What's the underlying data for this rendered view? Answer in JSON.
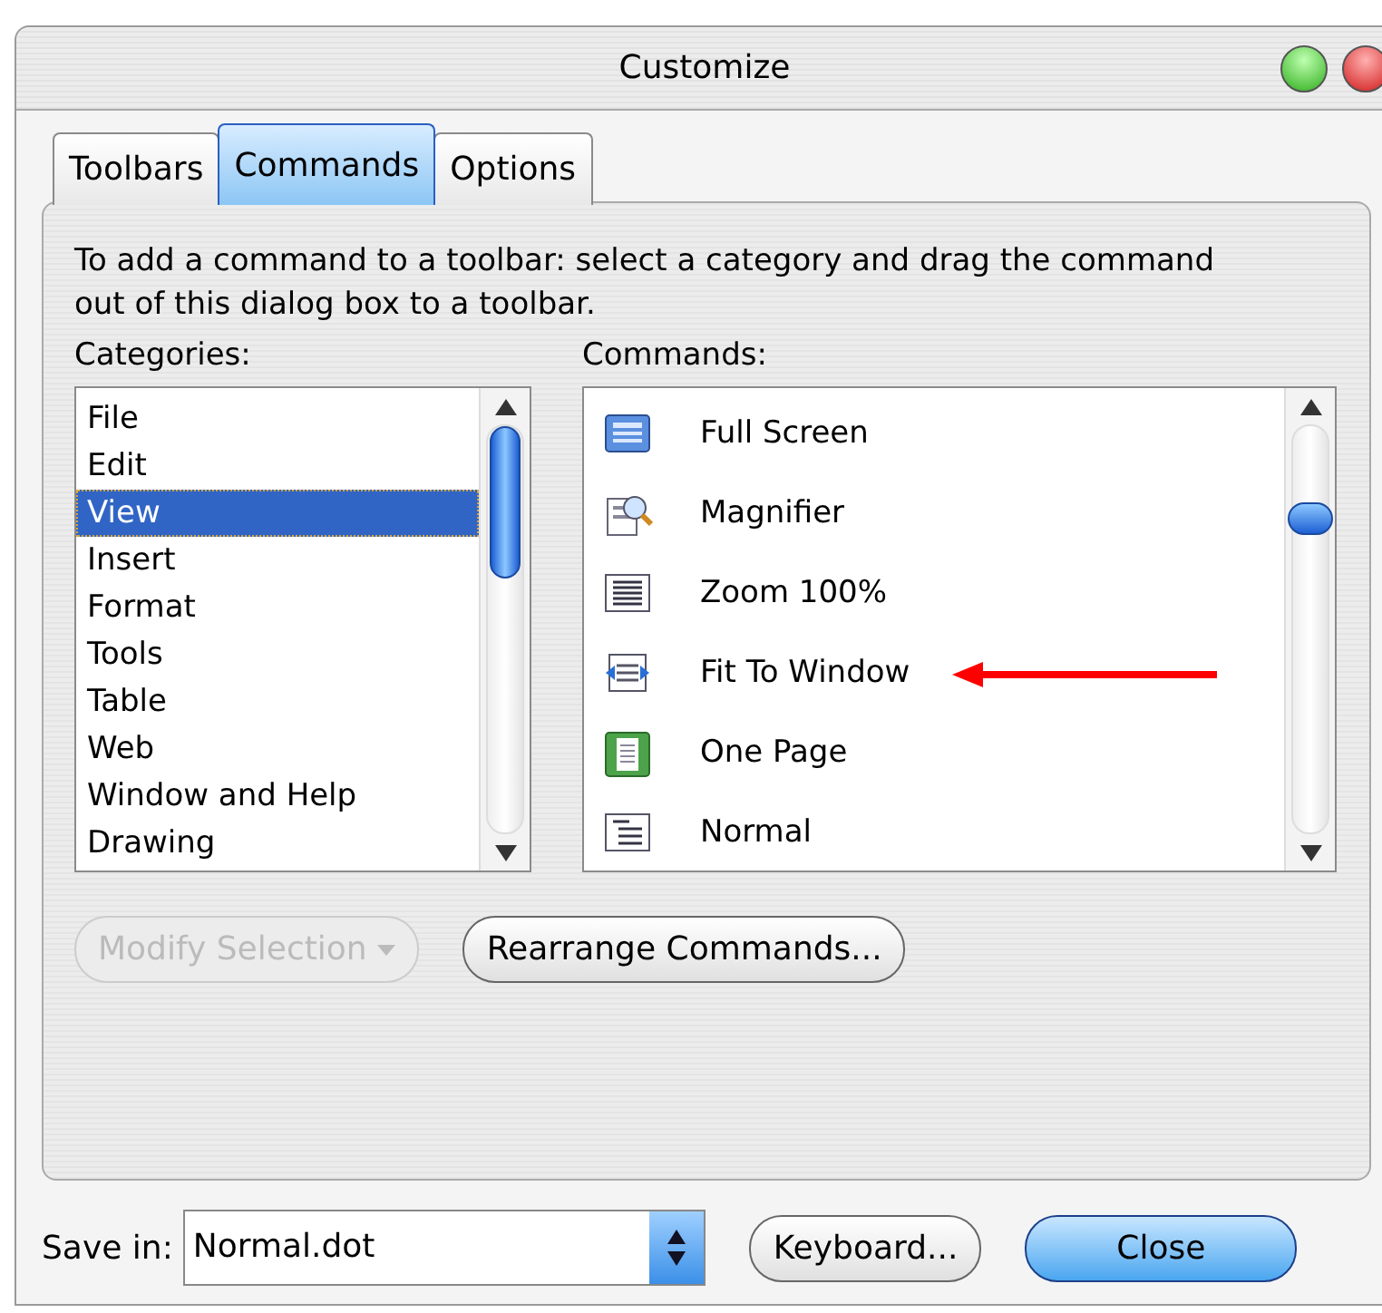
{
  "window": {
    "title": "Customize"
  },
  "tabs": [
    {
      "label": "Toolbars",
      "selected": false
    },
    {
      "label": "Commands",
      "selected": true
    },
    {
      "label": "Options",
      "selected": false
    }
  ],
  "instructions": "To add a command to a toolbar: select a category and drag the command out of this dialog box to a toolbar.",
  "categories": {
    "label": "Categories:",
    "items": [
      {
        "label": "File",
        "selected": false
      },
      {
        "label": "Edit",
        "selected": false
      },
      {
        "label": "View",
        "selected": true
      },
      {
        "label": "Insert",
        "selected": false
      },
      {
        "label": "Format",
        "selected": false
      },
      {
        "label": "Tools",
        "selected": false
      },
      {
        "label": "Table",
        "selected": false
      },
      {
        "label": "Web",
        "selected": false
      },
      {
        "label": "Window and Help",
        "selected": false
      },
      {
        "label": "Drawing",
        "selected": false
      }
    ]
  },
  "commands": {
    "label": "Commands:",
    "items": [
      {
        "label": "Full Screen",
        "kind": "screen",
        "annotated": false
      },
      {
        "label": "Magnifier",
        "kind": "magnifier",
        "annotated": false
      },
      {
        "label": "Zoom 100%",
        "kind": "lines",
        "annotated": false
      },
      {
        "label": "Fit To Window",
        "kind": "fit",
        "annotated": true
      },
      {
        "label": "One Page",
        "kind": "page",
        "annotated": false
      },
      {
        "label": "Normal",
        "kind": "normal",
        "annotated": false
      }
    ]
  },
  "panel_buttons": [
    {
      "label": "Modify Selection",
      "kind": "dropdown",
      "disabled": true
    },
    {
      "label": "Rearrange Commands...",
      "kind": "push",
      "disabled": false
    }
  ],
  "save_in": {
    "label": "Save in:",
    "value": "Normal.dot"
  },
  "footer_buttons": [
    {
      "label": "Keyboard...",
      "kind": "push",
      "disabled": false
    },
    {
      "label": "Close",
      "kind": "default",
      "disabled": false
    }
  ]
}
